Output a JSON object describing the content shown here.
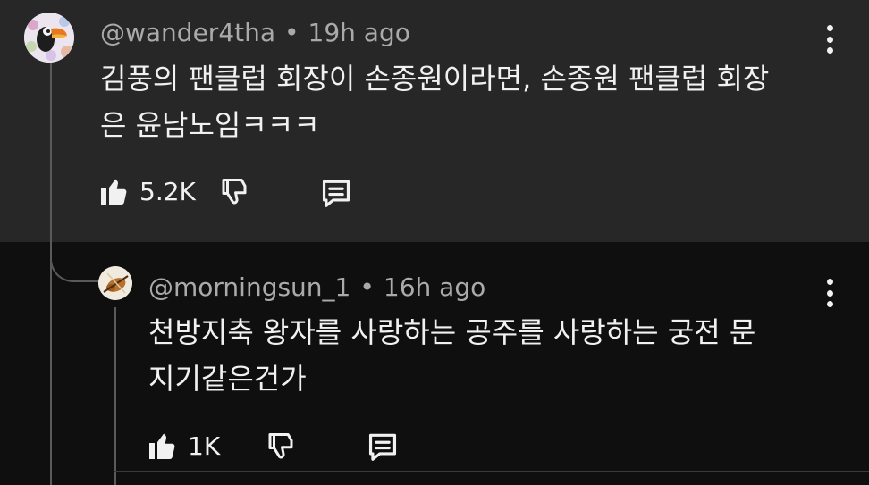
{
  "comments": [
    {
      "username": "@wander4tha",
      "separator": "•",
      "time": "19h ago",
      "lines": [
        "김풍의 팬클럽 회장이 손종원이라면, 손종원 팬클럽 회장",
        "은 윤남노임ㅋㅋㅋ"
      ],
      "likes": "5.2K",
      "icons": [
        "avatar",
        "thumb-up-icon",
        "thumb-down-icon",
        "reply-icon",
        "more-vert-icon"
      ]
    },
    {
      "username": "@morningsun_1",
      "separator": "•",
      "time": "16h ago",
      "lines": [
        "천방지축 왕자를 사랑하는 공주를 사랑하는 궁전 문",
        "지기같은건가"
      ],
      "likes": "1K",
      "icons": [
        "avatar",
        "thumb-up-icon",
        "thumb-down-icon",
        "reply-icon",
        "more-vert-icon"
      ]
    }
  ],
  "colors": {
    "background": "#0f0f0f",
    "highlight_block": "#272727",
    "meta_text": "#aaaaaa",
    "text": "#f1f1f1",
    "thread_line": "#5a5a5a"
  }
}
